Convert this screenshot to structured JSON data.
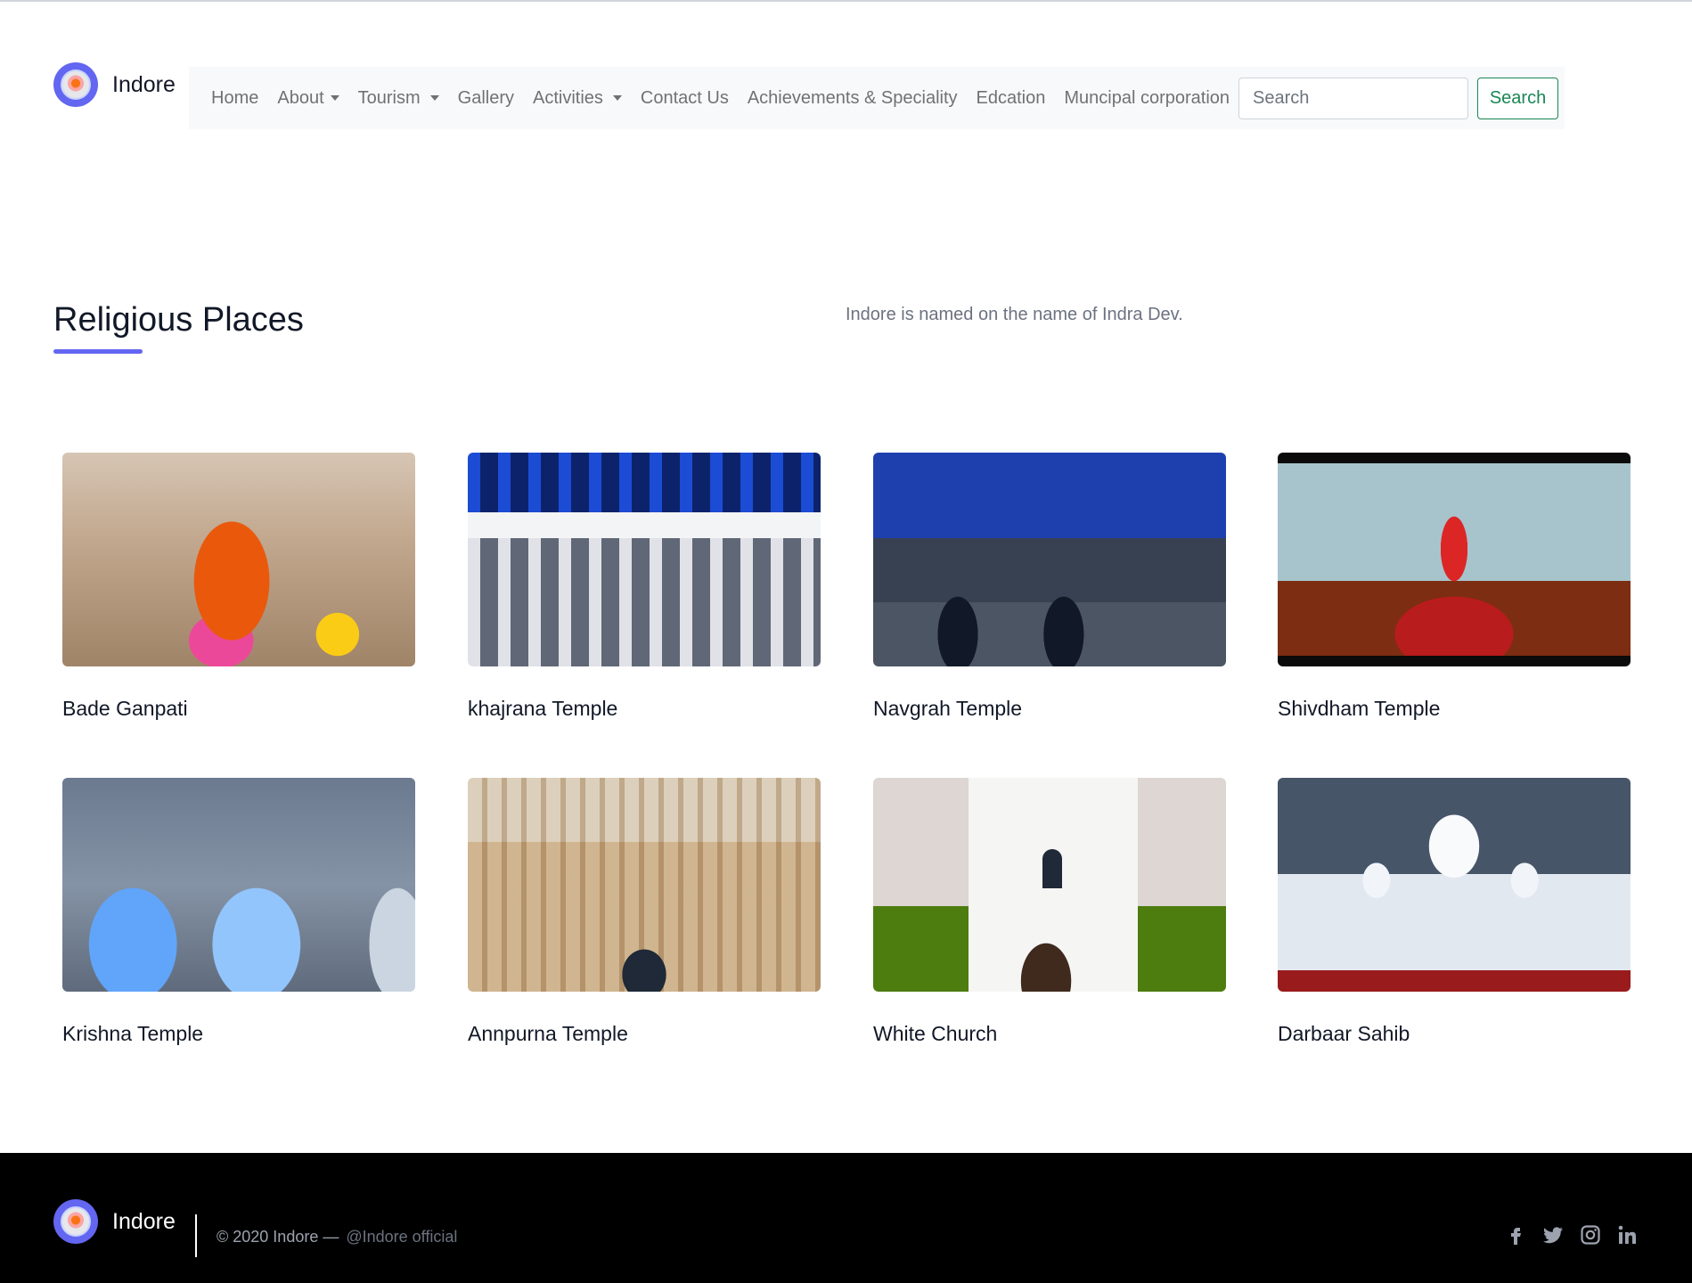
{
  "brand": {
    "name": "Indore"
  },
  "nav": {
    "items": [
      {
        "label": "Home",
        "dropdown": false
      },
      {
        "label": "About",
        "dropdown": true
      },
      {
        "label": "Tourism",
        "dropdown": true
      },
      {
        "label": "Gallery",
        "dropdown": false
      },
      {
        "label": "Activities",
        "dropdown": true
      },
      {
        "label": "Contact Us",
        "dropdown": false
      },
      {
        "label": "Achievements & Speciality",
        "dropdown": false
      },
      {
        "label": "Edcation",
        "dropdown": false
      },
      {
        "label": "Muncipal corporation",
        "dropdown": false
      }
    ],
    "search_placeholder": "Search",
    "search_button": "Search"
  },
  "section": {
    "title": "Religious Places",
    "subtitle": "Indore is named on the name of Indra Dev.",
    "accent_color": "#6366f1"
  },
  "places": [
    {
      "name": "Bade Ganpati"
    },
    {
      "name": "khajrana Temple"
    },
    {
      "name": "Navgrah Temple"
    },
    {
      "name": "Shivdham Temple"
    },
    {
      "name": "Krishna Temple"
    },
    {
      "name": "Annpurna Temple"
    },
    {
      "name": "White Church"
    },
    {
      "name": "Darbaar Sahib"
    }
  ],
  "footer": {
    "brand": "Indore",
    "copyright": "© 2020 Indore —",
    "handle": "@Indore official",
    "socials": [
      "facebook-icon",
      "twitter-icon",
      "instagram-icon",
      "linkedin-icon"
    ]
  }
}
